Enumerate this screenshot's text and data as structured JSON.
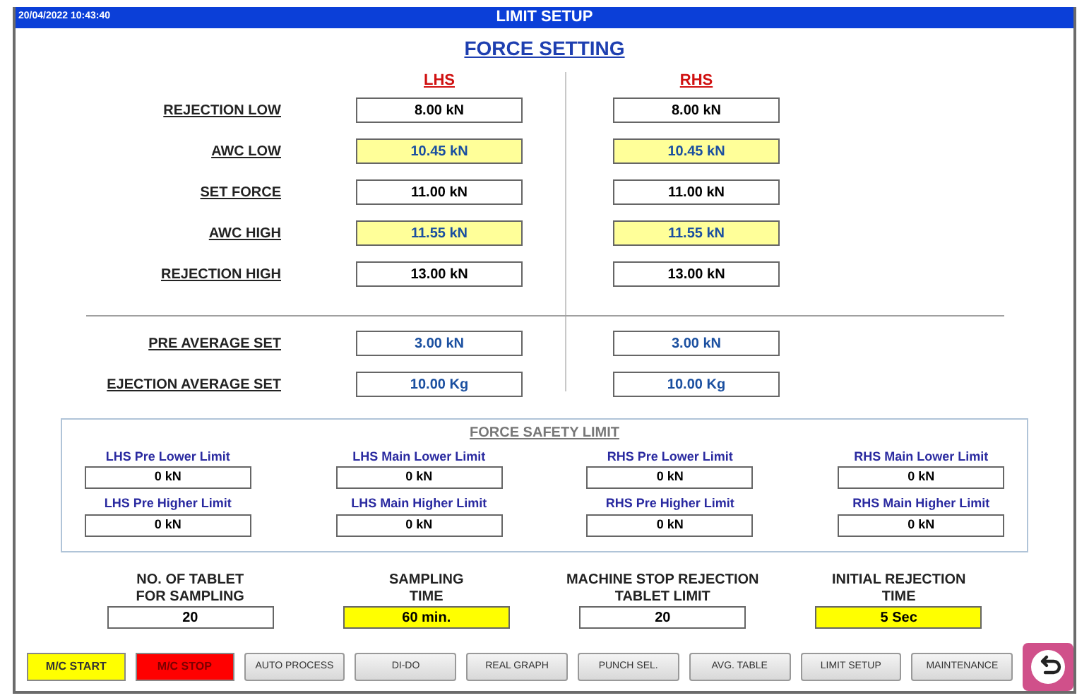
{
  "header": {
    "datetime": "20/04/2022 10:43:40",
    "title": "LIMIT SETUP"
  },
  "force_setting": {
    "title": "FORCE SETTING",
    "columns": [
      "LHS",
      "RHS"
    ],
    "rows": [
      {
        "label": "REJECTION LOW",
        "highlighted": false,
        "values": [
          "8.00 kN",
          "8.00 kN"
        ]
      },
      {
        "label": "AWC LOW",
        "highlighted": true,
        "values": [
          "10.45 kN",
          "10.45 kN"
        ]
      },
      {
        "label": "SET FORCE",
        "highlighted": false,
        "values": [
          "11.00 kN",
          "11.00 kN"
        ]
      },
      {
        "label": "AWC HIGH",
        "highlighted": true,
        "values": [
          "11.55 kN",
          "11.55 kN"
        ]
      },
      {
        "label": "REJECTION HIGH",
        "highlighted": false,
        "values": [
          "13.00 kN",
          "13.00 kN"
        ]
      }
    ],
    "average_rows": [
      {
        "label": "PRE AVERAGE SET",
        "values": [
          "3.00 kN",
          "3.00 kN"
        ]
      },
      {
        "label": "EJECTION AVERAGE SET",
        "values": [
          "10.00 Kg",
          "10.00 Kg"
        ]
      }
    ]
  },
  "force_safety_limit": {
    "title": "FORCE SAFETY LIMIT",
    "fields": [
      {
        "label": "LHS Pre Lower Limit",
        "value": "0 kN"
      },
      {
        "label": "LHS Main Lower Limit",
        "value": "0 kN"
      },
      {
        "label": "RHS Pre Lower Limit",
        "value": "0 kN"
      },
      {
        "label": "RHS Main Lower Limit",
        "value": "0 kN"
      },
      {
        "label": "LHS Pre Higher Limit",
        "value": "0 kN"
      },
      {
        "label": "LHS Main Higher Limit",
        "value": "0 kN"
      },
      {
        "label": "RHS Pre Higher Limit",
        "value": "0 kN"
      },
      {
        "label": "RHS Main Higher Limit",
        "value": "0 kN"
      }
    ]
  },
  "settings": [
    {
      "label_lines": [
        "NO. OF TABLET",
        "FOR SAMPLING"
      ],
      "value": "20",
      "highlighted": false
    },
    {
      "label_lines": [
        "SAMPLING",
        "TIME"
      ],
      "value": "60 min.",
      "highlighted": true
    },
    {
      "label_lines": [
        "MACHINE STOP REJECTION",
        "TABLET LIMIT"
      ],
      "value": "20",
      "highlighted": false
    },
    {
      "label_lines": [
        "INITIAL REJECTION",
        "TIME"
      ],
      "value": "5 Sec",
      "highlighted": true
    }
  ],
  "buttons": [
    {
      "kind": "start",
      "label": "M/C START"
    },
    {
      "kind": "stop",
      "label": "M/C STOP"
    },
    {
      "kind": "nav",
      "label": "AUTO PROCESS"
    },
    {
      "kind": "nav",
      "label": "DI-DO"
    },
    {
      "kind": "nav",
      "label": "REAL GRAPH"
    },
    {
      "kind": "nav",
      "label": "PUNCH SEL."
    },
    {
      "kind": "nav",
      "label": "AVG. TABLE"
    },
    {
      "kind": "nav",
      "label": "LIMIT SETUP"
    },
    {
      "kind": "nav",
      "label": "MAINTENANCE"
    },
    {
      "kind": "back"
    }
  ]
}
